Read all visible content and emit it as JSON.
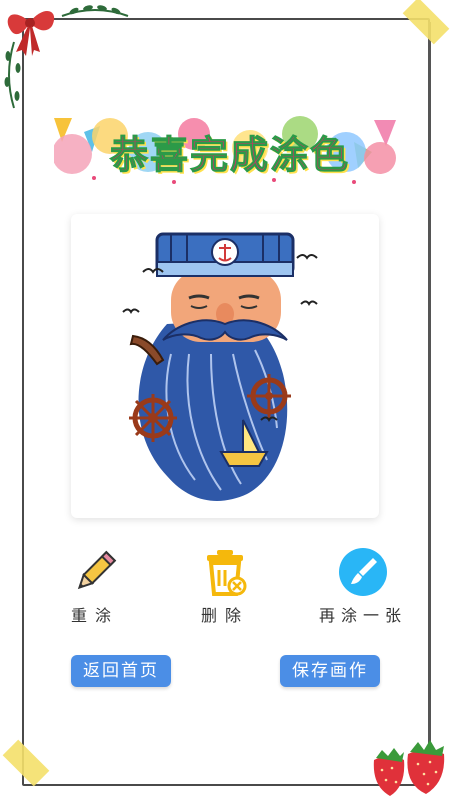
{
  "banner": {
    "title": "恭喜完成涂色"
  },
  "artwork": {
    "subject": "sailor-beard-illustration"
  },
  "actions": {
    "redo": {
      "label": "重涂",
      "icon": "pencil-icon"
    },
    "delete": {
      "label": "删除",
      "icon": "trash-icon"
    },
    "again": {
      "label": "再涂一张",
      "icon": "brush-icon"
    }
  },
  "buttons": {
    "home": "返回首页",
    "save": "保存画作"
  },
  "colors": {
    "accent_blue": "#4b8ee6",
    "trash_yellow": "#f5b80c",
    "brush_cyan": "#29b6f6",
    "frame_dark": "#4a4a4a"
  }
}
